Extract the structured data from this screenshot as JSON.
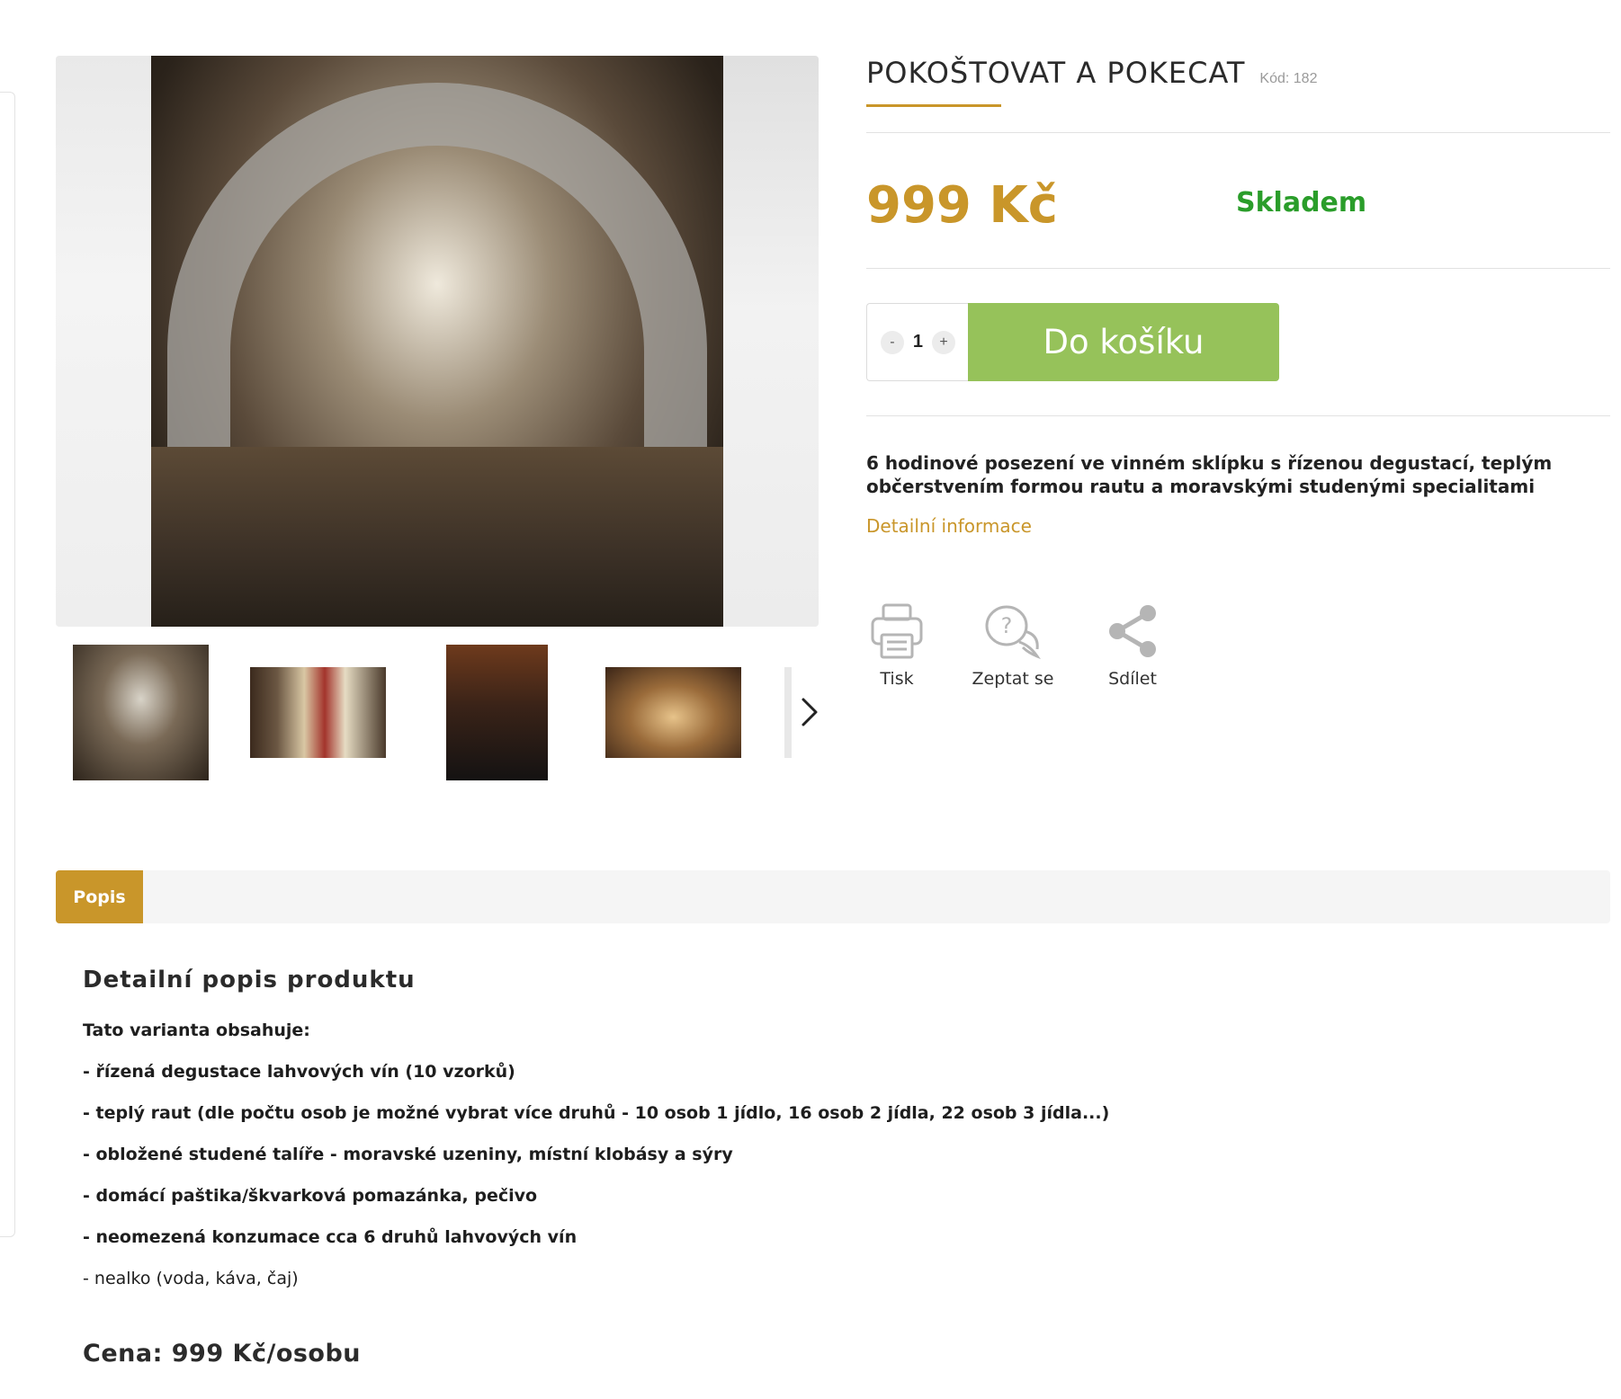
{
  "product": {
    "title": "POKOŠTOVAT A POKECAT",
    "code": "Kód: 182",
    "price": "999 Kč",
    "availability": "Skladem",
    "quantity": "1",
    "minus_label": "-",
    "plus_label": "+",
    "add_to_cart": "Do košíku",
    "short_description": "6 hodinové posezení ve vinném sklípku s řízenou degustací, teplým občerstvením formou rautu a moravskými studenými specialitami",
    "detail_link": "Detailní informace"
  },
  "gallery": {
    "main_image": "wine-cellar-photo",
    "thumbnails": [
      "wine-cellar-thumb",
      "wine-bottles-thumb",
      "people-thumb",
      "cellar-table-thumb",
      "more-thumb"
    ],
    "next_icon": "chevron-right-icon"
  },
  "actions": [
    {
      "label": "Tisk",
      "icon": "printer-icon"
    },
    {
      "label": "Zeptat se",
      "icon": "question-bubble-icon"
    },
    {
      "label": "Sdílet",
      "icon": "share-icon"
    }
  ],
  "tabs": [
    {
      "label": "Popis",
      "active": true
    }
  ],
  "description": {
    "heading": "Detailní popis produktu",
    "lines": [
      {
        "text": "Tato varianta obsahuje:",
        "bold": true
      },
      {
        "text": "- řízená degustace lahvových vín (10 vzorků)",
        "bold": true
      },
      {
        "text": "- teplý raut (dle počtu osob je možné vybrat více druhů - 10 osob 1 jídlo, 16 osob 2 jídla, 22 osob 3 jídla...)",
        "bold": true
      },
      {
        "text": "- obložené studené talíře - moravské uzeniny, místní klobásy a sýry",
        "bold": true
      },
      {
        "text": "- domácí paštika/škvarková pomazánka, pečivo",
        "bold": true
      },
      {
        "text": "- neomezená konzumace cca 6 druhů lahvových vín",
        "bold": true
      },
      {
        "text": "- nealko (voda, káva, čaj)",
        "bold": false
      }
    ],
    "price_line": "Cena: 999 Kč/osobu"
  },
  "colors": {
    "accent": "#c9962a",
    "stock": "#2a9d2a",
    "cart_button": "#96c25a",
    "icon_gray": "#b5b5b5"
  }
}
